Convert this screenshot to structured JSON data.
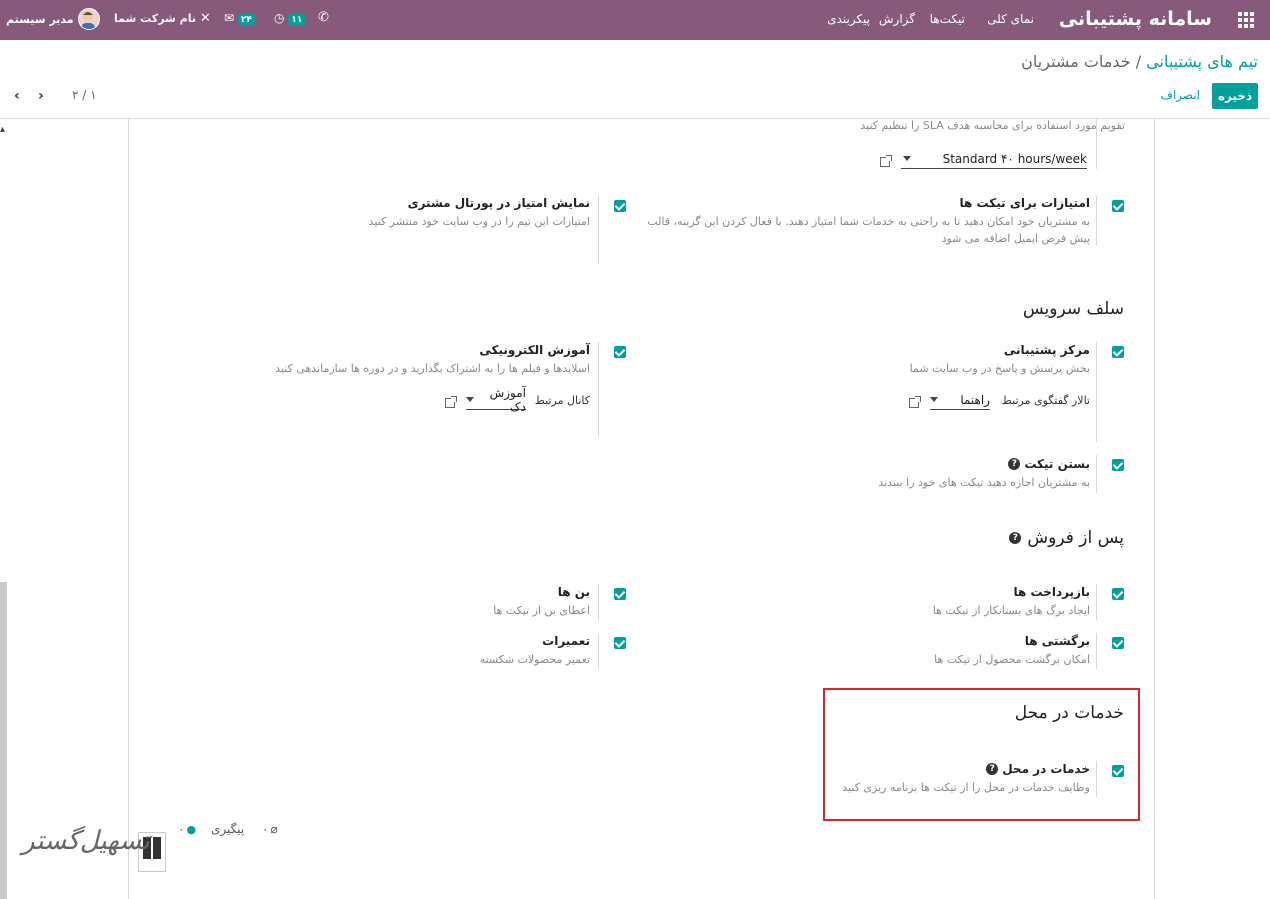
{
  "topbar": {
    "brand": "سامانه پشتیبانی",
    "menu": [
      "نمای کلی",
      "تیکت‌ها",
      "گزارش",
      "پیکربندی"
    ],
    "activity_count": "۱۱",
    "messages_count": "۲۴",
    "company": "نام شرکت شما",
    "user": "مدیر سیستم",
    "colors": {
      "bar": "#875a7b",
      "accent": "#00a09d"
    }
  },
  "breadcrumb": {
    "parent": "تیم های پشتیبانی",
    "separator": " / ",
    "current": "خدمات مشتریان"
  },
  "buttons": {
    "save": "ذخیره",
    "discard": "انصراف"
  },
  "pager": {
    "text": "۲ / ۱"
  },
  "sla": {
    "desc": "تقویم مورد استفاده برای محاسبه هدف SLA را تنظیم کنید",
    "value": "Standard ۴۰ hours/week"
  },
  "ratings": {
    "label": "امتیازات برای تیکت ها",
    "desc": "به مشتریان خود امکان دهید تا به راحتی به خدمات شما امتیاز دهند. با فعال کردن این گزینه، قالب پیش فرض ایمیل اضافه می شود"
  },
  "portal_rating": {
    "label": "نمایش امتیاز در پورتال مشتری",
    "desc": "امتیازات این تیم را در وب سایت خود منتشر کنید"
  },
  "self_service": {
    "title": "سلف سرویس",
    "help_center": {
      "label": "مرکز پشتیبانی",
      "desc": "بخش پرسش و پاسخ در وب سایت شما",
      "field_label": "تالار گفتگوی مرتبط",
      "field_value": "راهنما"
    },
    "elearning": {
      "label": "آموزش الکترونیکی",
      "desc": "اسلایدها و فیلم ها را به اشتراک بگذارید و در دوره ها سازماندهی کنید",
      "field_label": "کانال مرتبط",
      "field_value": "آموزش دک"
    },
    "closing": {
      "label": "بستن تیکت",
      "desc": "به مشتریان اجازه دهید تیکت های خود را ببندند"
    }
  },
  "after_sales": {
    "title": "پس از فروش",
    "refunds": {
      "label": "بازپرداخت ها",
      "desc": "ایجاد برگ های بستانکار از تیکت ها"
    },
    "coupons": {
      "label": "بن ها",
      "desc": "اعطای بن از تیکت ها"
    },
    "returns": {
      "label": "برگشتی ها",
      "desc": "امکان برگشت محصول از تیکت ها"
    },
    "repairs": {
      "label": "تعمیرات",
      "desc": "تعمیر محصولات شکسته"
    }
  },
  "field_service": {
    "title": "خدمات در محل",
    "item": {
      "label": "خدمات در محل",
      "desc": "وظایف خدمات در محل را از تیکت ها برنامه ریزی کنید"
    }
  },
  "chatter": {
    "attachments": "۰",
    "followers": "۰",
    "follow": "پیگیری"
  },
  "watermark": "تسهیل‌گستر"
}
